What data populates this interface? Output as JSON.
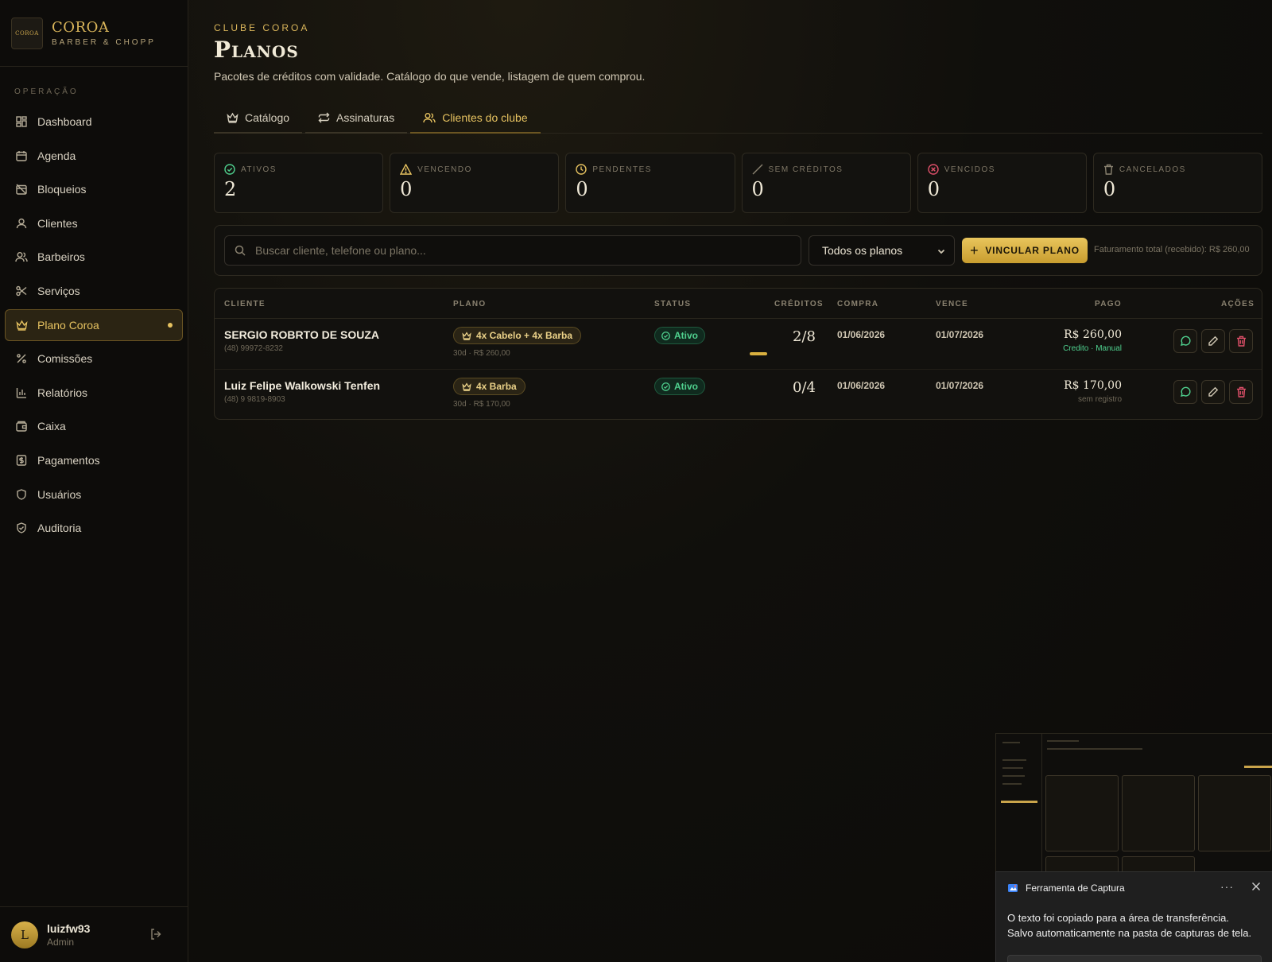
{
  "brand": {
    "name": "COROA",
    "subtitle": "BARBER & CHOPP",
    "logo_text": "COROA"
  },
  "sidebar": {
    "section": "OPERAÇÃO",
    "items": [
      {
        "label": "Dashboard",
        "icon": "grid-icon"
      },
      {
        "label": "Agenda",
        "icon": "calendar-icon"
      },
      {
        "label": "Bloqueios",
        "icon": "calendar-off-icon"
      },
      {
        "label": "Clientes",
        "icon": "user-icon"
      },
      {
        "label": "Barbeiros",
        "icon": "users-icon"
      },
      {
        "label": "Serviços",
        "icon": "scissors-icon"
      },
      {
        "label": "Plano Coroa",
        "icon": "crown-icon",
        "active": true
      },
      {
        "label": "Comissões",
        "icon": "percent-icon"
      },
      {
        "label": "Relatórios",
        "icon": "bar-chart-icon"
      },
      {
        "label": "Caixa",
        "icon": "wallet-icon"
      },
      {
        "label": "Pagamentos",
        "icon": "dollar-icon"
      },
      {
        "label": "Usuários",
        "icon": "shield-icon"
      },
      {
        "label": "Auditoria",
        "icon": "shield-check-icon"
      }
    ]
  },
  "user": {
    "initial": "L",
    "name": "luizfw93",
    "role": "Admin"
  },
  "header": {
    "eyebrow": "CLUBE COROA",
    "title": "Planos",
    "subtitle": "Pacotes de créditos com validade. Catálogo do que vende, listagem de quem comprou."
  },
  "tabs": [
    {
      "label": "Catálogo",
      "icon": "crown-icon"
    },
    {
      "label": "Assinaturas",
      "icon": "repeat-icon"
    },
    {
      "label": "Clientes do clube",
      "icon": "users-icon",
      "active": true
    }
  ],
  "stats": [
    {
      "label": "ATIVOS",
      "value": "2",
      "icon": "check-circle-icon",
      "color": "#4fd08e"
    },
    {
      "label": "VENCENDO",
      "value": "0",
      "icon": "alert-triangle-icon",
      "color": "#e6c260"
    },
    {
      "label": "PENDENTES",
      "value": "0",
      "icon": "clock-icon",
      "color": "#e6c260"
    },
    {
      "label": "SEM CRÉDITOS",
      "value": "0",
      "icon": "slash-icon",
      "color": "#8a8270"
    },
    {
      "label": "VENCIDOS",
      "value": "0",
      "icon": "x-circle-icon",
      "color": "#e0506a"
    },
    {
      "label": "CANCELADOS",
      "value": "0",
      "icon": "trash-icon",
      "color": "#8a8270"
    }
  ],
  "filters": {
    "search_placeholder": "Buscar cliente, telefone ou plano...",
    "plan_select": "Todos os planos",
    "link_button": "VINCULAR PLANO",
    "revenue": "Faturamento total (recebido): R$ 260,00"
  },
  "table": {
    "columns": [
      "CLIENTE",
      "PLANO",
      "STATUS",
      "CRÉDITOS",
      "COMPRA",
      "VENCE",
      "PAGO",
      "AÇÕES"
    ],
    "rows": [
      {
        "name": "SERGIO ROBRTO DE SOUZA",
        "phone": "(48) 99972-8232",
        "plan": "4x Cabelo + 4x Barba",
        "plan_sub": "30d · R$ 260,00",
        "status": "Ativo",
        "credits": "2/8",
        "credits_used_fraction": 0.25,
        "purchase": "01/06/2026",
        "expires": "01/07/2026",
        "paid": "R$ 260,00",
        "paid_sub": "Credito · Manual"
      },
      {
        "name": "Luiz Felipe Walkowski Tenfen",
        "phone": "(48) 9 9819-8903",
        "plan": "4x Barba",
        "plan_sub": "30d · R$ 170,00",
        "status": "Ativo",
        "credits": "0/4",
        "credits_used_fraction": 0,
        "purchase": "01/06/2026",
        "expires": "01/07/2026",
        "paid": "R$ 170,00",
        "paid_sub": "sem registro"
      }
    ]
  },
  "toast": {
    "app": "Ferramenta de Captura",
    "more": "···",
    "line1": "O texto foi copiado para a área de transferência.",
    "line2": "Salvo automaticamente na pasta de capturas de tela."
  },
  "colors": {
    "accent": "#e6c260",
    "success": "#4fd08e",
    "danger": "#e0506a",
    "background": "#0c0b09"
  }
}
